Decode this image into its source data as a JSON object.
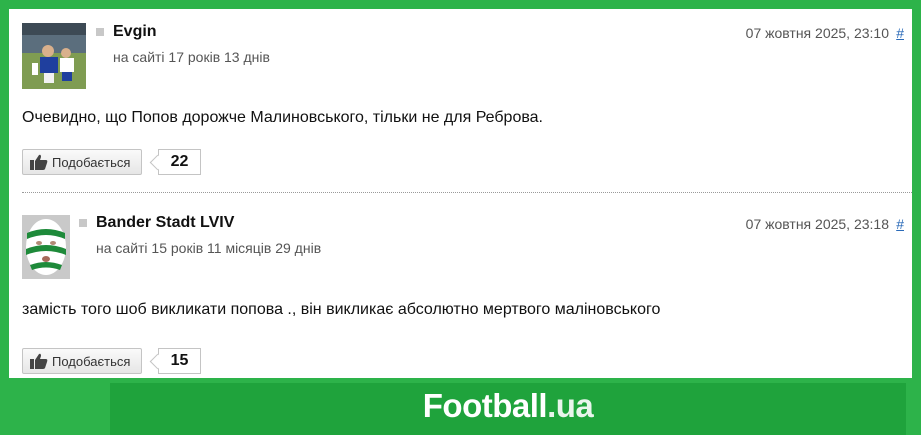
{
  "comments": [
    {
      "username": "Evgin",
      "membership": "на сайті 17 років 13 днів",
      "date": "07 жовтня 2025, 23:10",
      "permalink": "#",
      "text": "Очевидно, що Попов дорожче Малиновського, тільки не для Реброва.",
      "like_label": "Подобається",
      "like_count": "22"
    },
    {
      "username": "Bander Stadt LVIV",
      "membership": "на сайті 15 років 11 місяців 29 днів",
      "date": "07 жовтня 2025, 23:18",
      "permalink": "#",
      "text": "замість того шоб викликати попова ., він викликає абсолютно мертвого маліновського",
      "like_label": "Подобається",
      "like_count": "15"
    }
  ],
  "footer": {
    "logo_main": "Football",
    "logo_dot": ".ua"
  },
  "colors": {
    "brand_green": "#2db34a",
    "footer_green": "#1fa33c",
    "link": "#2a6ab8"
  }
}
